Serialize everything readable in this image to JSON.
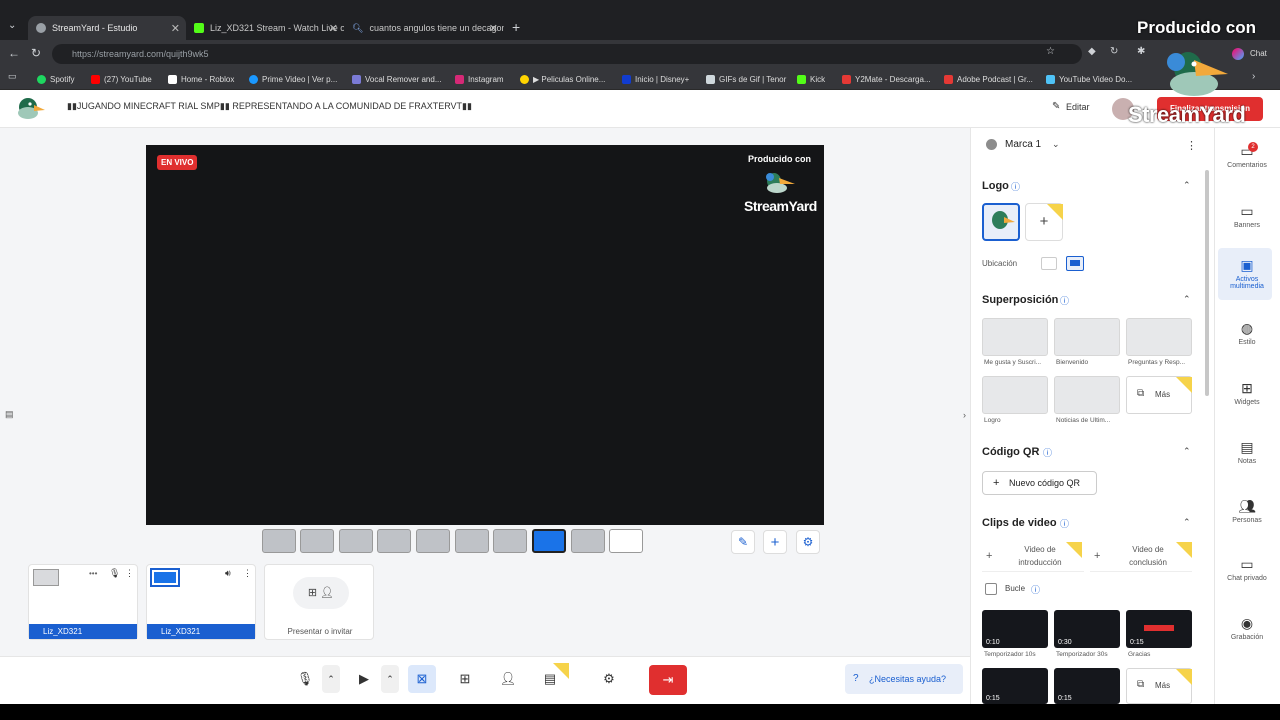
{
  "browser": {
    "tabs": [
      {
        "title": "StreamYard - Estudio",
        "active": true
      },
      {
        "title": "Liz_XD321 Stream - Watch Live on",
        "active": false
      },
      {
        "title": "cuantos angulos tiene un decagon",
        "active": false
      }
    ],
    "url": "https://streamyard.com/quijth9wk5",
    "bookmarks": [
      "Spotify",
      "(27) YouTube",
      "Home - Roblox",
      "Prime Video | Ver p...",
      "Vocal Remover and...",
      "Instagram",
      "▶ Peliculas Online...",
      "Inicio | Disney+",
      "GIFs de Gif | Tenor",
      "Kick",
      "Y2Mate - Descarga...",
      "Adobe Podcast | Gr...",
      "YouTube Video Do..."
    ],
    "chat_label": "Chat"
  },
  "header": {
    "title": "▮▮JUGANDO MINECRAFT RIAL SMP▮▮ REPRESENTANDO A LA COMUNIDAD DE FRAXTERVT▮▮",
    "edit_label": "Editar",
    "end_label": "Finalizar transmisión"
  },
  "watermark": {
    "produced": "Producido con",
    "brand": "StreamYard"
  },
  "stage": {
    "live_badge": "EN VIVO",
    "produced": "Producido con",
    "brand": "StreamYard"
  },
  "participants": [
    {
      "name": "Liz_XD321"
    },
    {
      "name": "Liz_XD321"
    }
  ],
  "invite_label": "Presentar o invitar",
  "help_label": "¿Necesitas ayuda?",
  "panel": {
    "brand_name": "Marca 1",
    "logo_title": "Logo",
    "location_label": "Ubicación",
    "overlay_title": "Superposición",
    "overlays": [
      "Me gusta y Suscri...",
      "Bienvenido",
      "Preguntas y Resp...",
      "Logro",
      "Noticias de Últim..."
    ],
    "more_label": "Más",
    "qr_title": "Código QR",
    "qr_button": "Nuevo código QR",
    "clips_title": "Clips de video",
    "intro_label": "Video de introducción",
    "outro_label": "Video de conclusión",
    "loop_label": "Bucle",
    "clips": [
      {
        "time": "0:10",
        "label": "Temporizador 10s"
      },
      {
        "time": "0:30",
        "label": "Temporizador 30s"
      },
      {
        "time": "0:15",
        "label": "Gracias"
      }
    ],
    "clips_row2": [
      "0:15",
      "0:15"
    ]
  },
  "rail": [
    {
      "label": "Comentarios",
      "icon": "comment-icon",
      "badge": "2"
    },
    {
      "label": "Banners",
      "icon": "banner-icon"
    },
    {
      "label": "Activos multimedia",
      "icon": "media-icon",
      "active": true
    },
    {
      "label": "Estilo",
      "icon": "palette-icon"
    },
    {
      "label": "Widgets",
      "icon": "widgets-icon"
    },
    {
      "label": "Notas",
      "icon": "notes-icon"
    },
    {
      "label": "Personas",
      "icon": "people-icon"
    },
    {
      "label": "Chat privado",
      "icon": "chat-icon"
    },
    {
      "label": "Grabación",
      "icon": "record-icon"
    }
  ],
  "colors": {
    "accent": "#1a5fd0",
    "live": "#e02f2f",
    "end": "#e02f2f",
    "stage": "#141517"
  }
}
